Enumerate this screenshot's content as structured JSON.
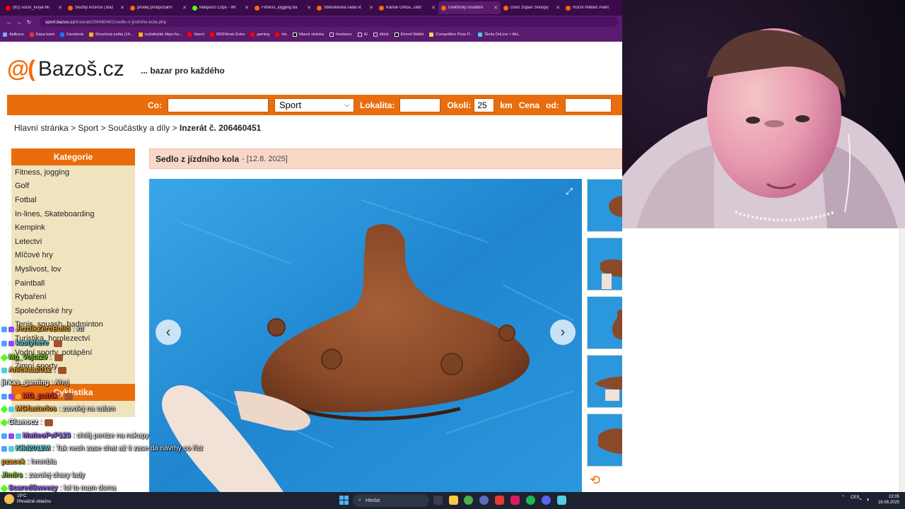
{
  "browser": {
    "tabs": [
      {
        "title": "(92) socio_luvya Mi"
      },
      {
        "title": "Služby inzerce | Baz"
      },
      {
        "title": "prodej protipožární"
      },
      {
        "title": "MatyasG Clips - Wi"
      },
      {
        "title": "Fitness, jogging ba"
      },
      {
        "title": "Sběratelská sada st"
      },
      {
        "title": "Kánoe Orlice, Žebr"
      },
      {
        "title": "Elektrický invalidní"
      },
      {
        "title": "Dívčí župan Snoopy"
      },
      {
        "title": "Roční hřebec Paint"
      }
    ],
    "url_host": "sport.bazos.cz",
    "url_path": "/inzerat/206460451/sedlo-z-jizdniho-kola.php",
    "bookmarks": [
      "Aplikace",
      "Equa bank",
      "Facebook",
      "Doručená pošta (14...",
      "kužatkolák https://w...",
      "hlavní",
      "MGFitman Extra",
      "gaming",
      "rbx",
      "Hlavní stránka",
      "freelance",
      "AI",
      "tiktok",
      "Elrond Wallet",
      "Competitive Prize P...",
      "Škola OnLine > Akt..."
    ]
  },
  "site": {
    "logo_mark": "@(",
    "logo_text": "Bazoš.cz",
    "tagline": "... bazar pro každého"
  },
  "search": {
    "co_label": "Co:",
    "co_value": "",
    "category_selected": "Sport",
    "lokalita_label": "Lokalita:",
    "lokalita_value": "",
    "okoli_label": "Okolí:",
    "okoli_value": "25",
    "km_label": "km",
    "cena_label": "Cena",
    "od_label": "od:",
    "od_value": ""
  },
  "breadcrumb": {
    "home": "Hlavní stránka",
    "sep": ">",
    "section": "Sport",
    "subsection": "Součástky a díly",
    "current": "Inzerát č. 206460451"
  },
  "categories": {
    "title": "Kategorie",
    "items": [
      "Fitness, jogging",
      "Golf",
      "Fotbal",
      "In-lines, Skateboarding",
      "Kempink",
      "Letectví",
      "Míčové hry",
      "Myslivost, lov",
      "Paintball",
      "Rybaření",
      "Společenské hry",
      "Tenis, squash, badminton",
      "Turistika, horolezectví",
      "Vodní sporty, potápění",
      "Zimní sporty"
    ],
    "cyklistika_title": "Cyklistika"
  },
  "ad": {
    "title": "Sedlo z jízdního kola",
    "date": "- [12.8. 2025]"
  },
  "chat": [
    {
      "user": "JezdikZeroBuild",
      "msg": ": xd",
      "color": "#f5a623"
    },
    {
      "user": "kastyhere",
      "msg": "",
      "color": "#4dd0e1"
    },
    {
      "user": "Mg_Vojta29",
      "msg": ":",
      "color": "#7ed321"
    },
    {
      "user": "Anickaa2012",
      "msg": ":",
      "color": "#f5a623"
    },
    {
      "user": "jirkas_gaming",
      "msg": ": Ahoj",
      "color": "#ffffff"
    },
    {
      "user": "MG_patrik",
      "msg": ":",
      "color": "#ff3b3b"
    },
    {
      "user": "MGfasterlos",
      "msg": ": zavolej na salam",
      "color": "#f5a623"
    },
    {
      "user": "Glamocz",
      "msg": ":",
      "color": "#ffffff"
    },
    {
      "user": "MatteoPvP123",
      "msg": ": chtěj penize na nakupy",
      "color": "#a06cff"
    },
    {
      "user": "Kiki2012M",
      "msg": ": Tak nech zase chat až ti zase dá návrhy co říct",
      "color": "#4dd0e1"
    },
    {
      "user": "pzacek",
      "msg": ": hmmbla",
      "color": "#f5a623"
    },
    {
      "user": "Jindrs",
      "msg": ": zavolej chary lady",
      "color": "#7ed321"
    },
    {
      "user": "ScaredSweezy",
      "msg": ": lol to mam doma",
      "color": "#a06cff"
    }
  ],
  "taskbar": {
    "weather_temp": "19°C",
    "weather_desc": "Převážně oblačno",
    "search_placeholder": "Hledat",
    "lang": "CES",
    "time": "22:05",
    "date": "18.08.2025"
  }
}
